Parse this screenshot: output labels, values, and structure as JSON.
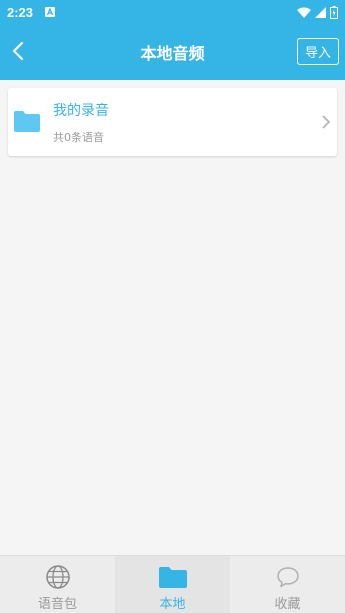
{
  "status_bar": {
    "time": "2:23"
  },
  "header": {
    "title": "本地音频",
    "import_label": "导入"
  },
  "folder_item": {
    "title": "我的录音",
    "subtitle": "共0条语音"
  },
  "tabs": [
    {
      "label": "语音包",
      "icon": "globe-icon",
      "active": false
    },
    {
      "label": "本地",
      "icon": "folder-icon",
      "active": true
    },
    {
      "label": "收藏",
      "icon": "chat-bubble-icon",
      "active": false
    }
  ],
  "colors": {
    "accent": "#35b4e6",
    "inactive": "#9a9a9a",
    "background": "#f5f5f5"
  }
}
